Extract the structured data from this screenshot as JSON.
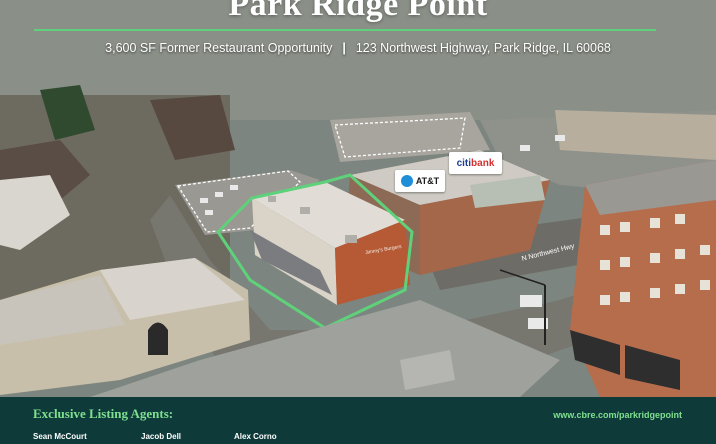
{
  "title": "Park Ridge Point",
  "subtitle": {
    "left": "3,600 SF Former Restaurant Opportunity",
    "divider": "|",
    "right": "123 Northwest Highway, Park Ridge, IL 60068"
  },
  "signs": {
    "att": "AT&T",
    "citibank_prefix": "citi",
    "citibank_suffix": "bank"
  },
  "road_label": "N Northwest Hwy",
  "storefront_label": "Jimmy's Burgers",
  "footer": {
    "heading": "Exclusive Listing Agents:",
    "url": "www.cbre.com/parkridgepoint",
    "agents": [
      "Sean McCourt",
      "Jacob Dell",
      "Alex Corno"
    ]
  },
  "colors": {
    "accent_green": "#5fd17a",
    "footer_bg": "#0f3a3a",
    "footer_text": "#7ee08f"
  }
}
